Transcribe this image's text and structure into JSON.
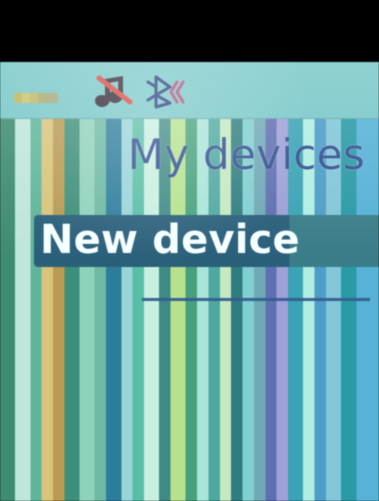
{
  "screen": {
    "title": "My devices",
    "items": [
      {
        "label": "New device"
      }
    ]
  },
  "status_bar": {
    "icons": [
      "signal-icon",
      "music-muted-icon",
      "bluetooth-icon"
    ]
  }
}
